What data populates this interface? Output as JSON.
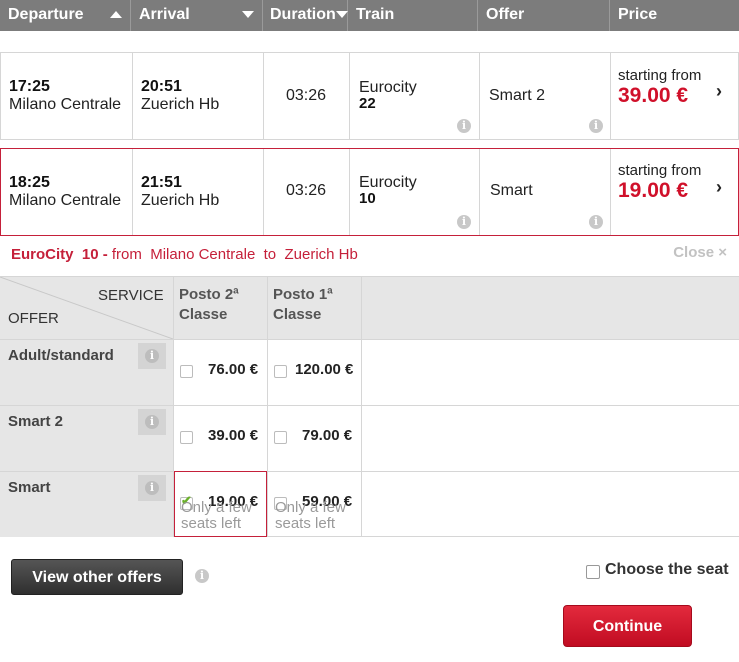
{
  "header": {
    "departure": "Departure",
    "arrival": "Arrival",
    "duration": "Duration",
    "train": "Train",
    "offer": "Offer",
    "price": "Price"
  },
  "trains": [
    {
      "dep_time": "17:25",
      "dep_station": "Milano Centrale",
      "arr_time": "20:51",
      "arr_station": "Zuerich Hb",
      "duration": "03:26",
      "train_type": "Eurocity",
      "train_number": "22",
      "offer": "Smart 2",
      "price_label": "starting from",
      "price": "39.00 €"
    },
    {
      "dep_time": "18:25",
      "dep_station": "Milano Centrale",
      "arr_time": "21:51",
      "arr_station": "Zuerich Hb",
      "duration": "03:26",
      "train_type": "Eurocity",
      "train_number": "10",
      "offer": "Smart",
      "price_label": "starting from",
      "price": "19.00 €"
    }
  ],
  "detail": {
    "train": "EuroCity",
    "number": "10 -",
    "from_label": "from",
    "from_station": "Milano Centrale",
    "to_label": "to",
    "to_station": "Zuerich Hb",
    "close": "Close ×",
    "service_label": "SERVICE",
    "offer_label": "OFFER",
    "class2": "Posto 2ª Classe",
    "class1": "Posto 1ª Classe",
    "offers": [
      {
        "name": "Adult/standard",
        "p2": "76.00 €",
        "p1": "120.00 €"
      },
      {
        "name": "Smart 2",
        "p2": "39.00 €",
        "p1": "79.00 €"
      },
      {
        "name": "Smart",
        "p2": "19.00 €",
        "p1": "59.00 €",
        "note2": "Only a few seats left",
        "note1": "Only a few seats left"
      }
    ]
  },
  "actions": {
    "view_other": "View other offers",
    "choose_seat": "Choose the seat",
    "continue": "Continue"
  },
  "colors": {
    "accent": "#c5203a",
    "price": "#d0102a",
    "header_bg": "#7c7c7c"
  },
  "icons": {
    "info": "info-icon",
    "sort_asc": "sort-up-icon",
    "sort_desc": "sort-down-icon",
    "chevron": "chevron-right-icon"
  }
}
